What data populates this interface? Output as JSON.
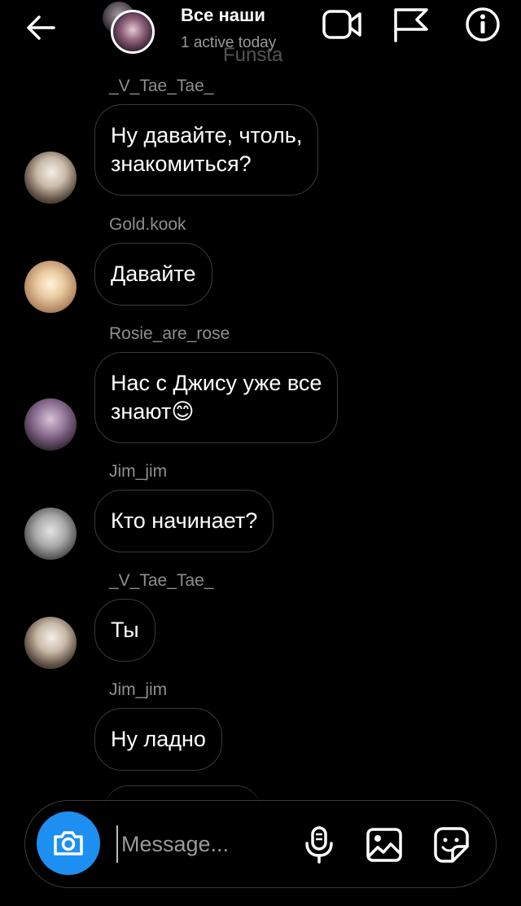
{
  "header": {
    "title": "Все наши",
    "status": "1 active today",
    "watermark": "Funsta",
    "icons": [
      "arrow-left-icon",
      "video-camera-icon",
      "flag-icon",
      "info-icon"
    ]
  },
  "messages": [
    {
      "sender": "_V_Tae_Tae_",
      "text": "Ну давайте, чтоль,\nзнакомиться?",
      "avatar": "tae"
    },
    {
      "sender": "Gold.kook",
      "text": "Давайте",
      "avatar": "gold"
    },
    {
      "sender": "Rosie_are_rose",
      "text": "Нас с Джису уже все\nзнают😊",
      "avatar": "rosie"
    },
    {
      "sender": "Jim_jim",
      "text": "Кто начинает?",
      "avatar": "jim"
    },
    {
      "sender": "_V_Tae_Tae_",
      "text": "Ты",
      "avatar": "tae"
    },
    {
      "sender": "Jim_jim",
      "text": "Ну ладно",
      "avatar": "jim"
    }
  ],
  "composer": {
    "placeholder": "Message...",
    "accent_color": "#1D8FF0",
    "icons": [
      "camera-icon",
      "microphone-icon",
      "gallery-icon",
      "sticker-icon"
    ]
  }
}
